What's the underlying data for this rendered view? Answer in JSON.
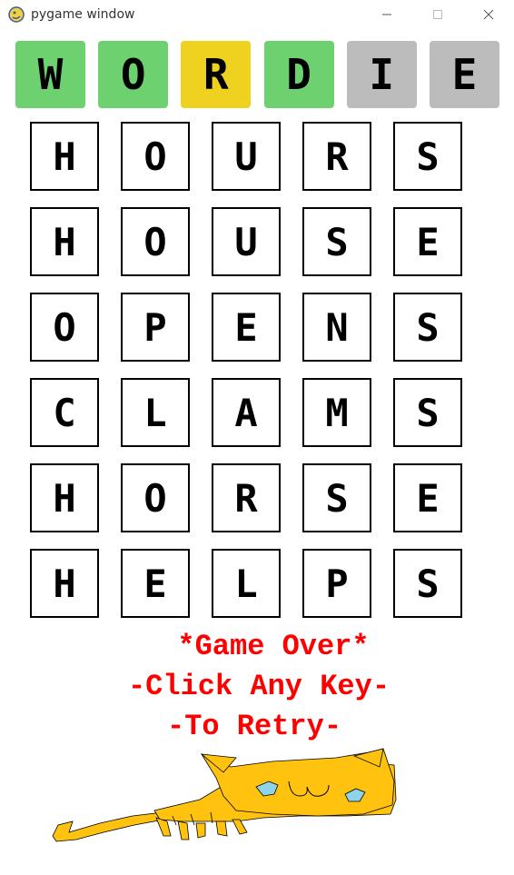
{
  "window": {
    "title": "pygame window",
    "icon": "pygame-snake-icon",
    "controls": [
      "minimize-icon",
      "maximize-icon",
      "close-icon"
    ]
  },
  "logo": {
    "tiles": [
      {
        "letter": "W",
        "color": "#6dd16f"
      },
      {
        "letter": "O",
        "color": "#6dd16f"
      },
      {
        "letter": "R",
        "color": "#eed21f"
      },
      {
        "letter": "D",
        "color": "#6dd16f"
      },
      {
        "letter": "I",
        "color": "#bcbcbc"
      },
      {
        "letter": "E",
        "color": "#bcbcbc"
      }
    ]
  },
  "board": {
    "rows": [
      [
        "H",
        "O",
        "U",
        "R",
        "S"
      ],
      [
        "H",
        "O",
        "U",
        "S",
        "E"
      ],
      [
        "O",
        "P",
        "E",
        "N",
        "S"
      ],
      [
        "C",
        "L",
        "A",
        "M",
        "S"
      ],
      [
        "H",
        "O",
        "R",
        "S",
        "E"
      ],
      [
        "H",
        "E",
        "L",
        "P",
        "S"
      ]
    ]
  },
  "game_over": {
    "line1": "*Game Over*",
    "line2": "-Click Any Key-",
    "line3": "-To Retry-",
    "color": "#ff0000"
  },
  "mascot": {
    "icon": "cat-drawing",
    "body_color": "#ffc20e",
    "eye_color": "#8fd3e8"
  }
}
